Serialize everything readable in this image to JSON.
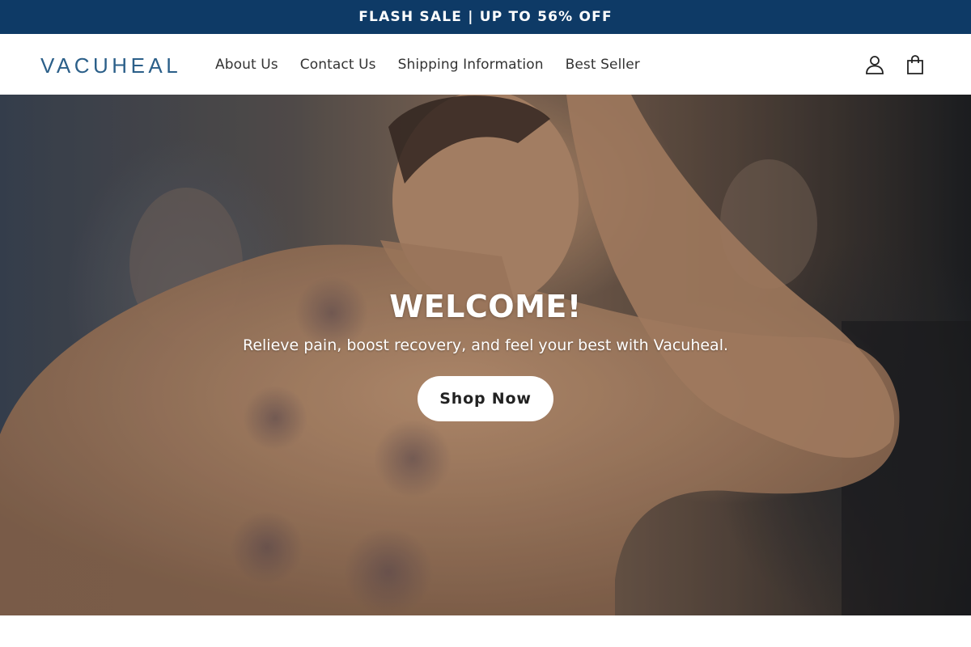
{
  "announcement": {
    "text": "FLASH SALE | UP TO 56% OFF"
  },
  "header": {
    "logo_text": "VACUHEAL",
    "nav": [
      {
        "label": "About Us"
      },
      {
        "label": "Contact Us"
      },
      {
        "label": "Shipping Information"
      },
      {
        "label": "Best Seller"
      }
    ],
    "icons": [
      "account-icon",
      "cart-icon"
    ]
  },
  "hero": {
    "title": "WELCOME!",
    "subtitle": "Relieve pain, boost recovery, and feel your best with Vacuheal.",
    "button_label": "Shop Now"
  },
  "colors": {
    "announcement_bg": "#0e3a66",
    "logo": "#2b5f89",
    "button_bg": "#ffffff"
  }
}
